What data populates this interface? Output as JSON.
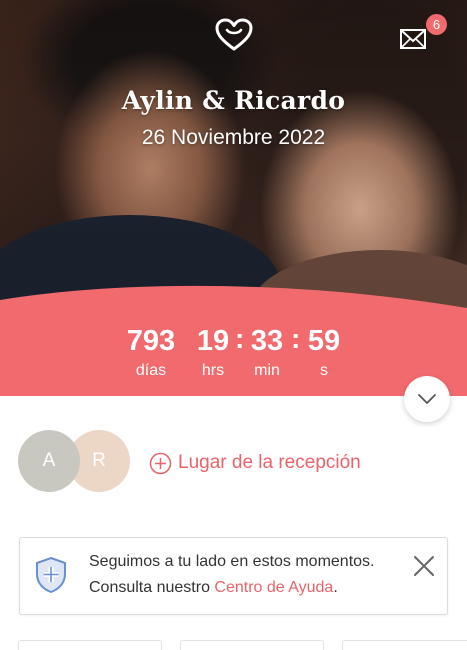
{
  "header": {
    "couple_name": "Aylin & Ricardo",
    "wedding_date": "26 Noviembre 2022",
    "notifications_count": "6"
  },
  "countdown": {
    "days": "793",
    "days_label": "días",
    "hours": "19",
    "hours_label": "hrs",
    "minutes": "33",
    "minutes_label": "min",
    "seconds": "59",
    "seconds_label": "s",
    "separator": ":"
  },
  "avatars": {
    "first_initial": "A",
    "second_initial": "R"
  },
  "venue": {
    "label": "Lugar de la recepción"
  },
  "help_card": {
    "line1": "Seguimos a tu lado en estos momentos.",
    "line2_prefix": "Consulta nuestro ",
    "link_text": "Centro de Ayuda",
    "line2_suffix": "."
  },
  "colors": {
    "accent": "#f06a6e",
    "link": "#e8646a",
    "shield": "#6a8fd0"
  },
  "icons": {
    "logo": "heart-icon",
    "messages": "envelope-icon",
    "expand": "chevron-down-icon",
    "add": "plus-circle-icon",
    "help": "shield-plus-icon",
    "dismiss": "close-icon"
  }
}
